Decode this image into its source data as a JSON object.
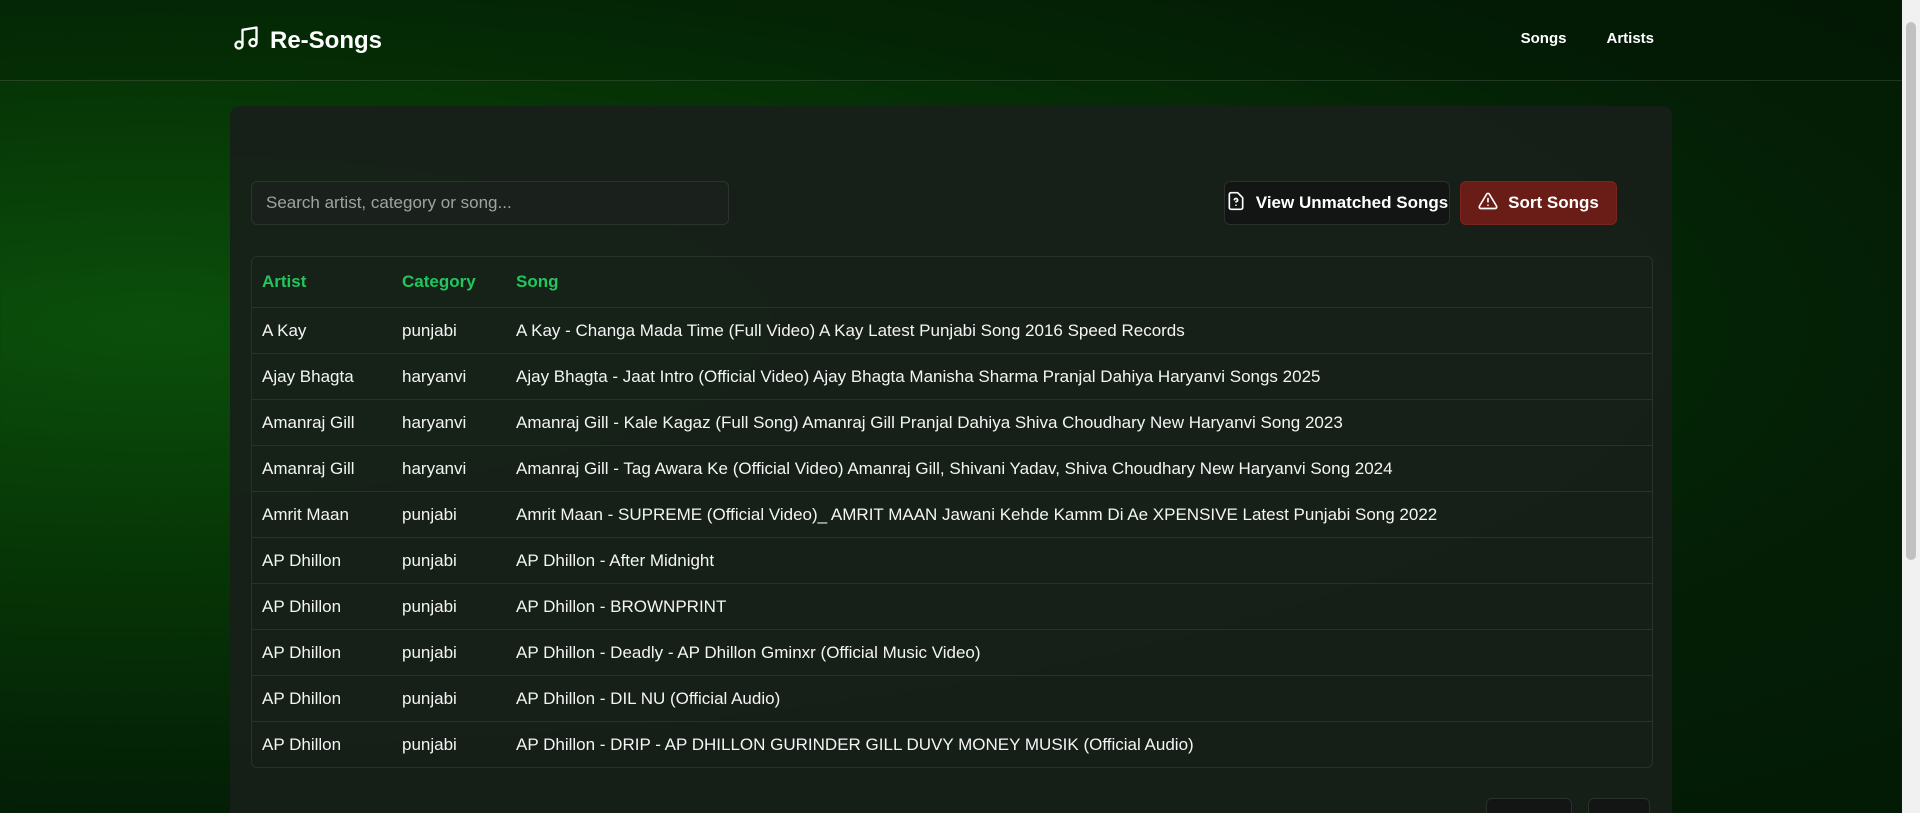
{
  "header": {
    "brand": "Re-Songs",
    "brand_icon": "music-note-icon",
    "nav": [
      "Songs",
      "Artists"
    ]
  },
  "search": {
    "placeholder": "Search artist, category or song...",
    "value": ""
  },
  "actions": {
    "unmatched_label": "View Unmatched Songs",
    "unmatched_icon": "file-question-icon",
    "sort_label": "Sort Songs",
    "sort_icon": "alert-triangle-icon"
  },
  "table": {
    "headers": [
      "Artist",
      "Category",
      "Song"
    ],
    "rows": [
      [
        "A Kay",
        "punjabi",
        "A Kay - Changa Mada Time (Full Video) A Kay Latest Punjabi Song 2016 Speed Records"
      ],
      [
        "Ajay Bhagta",
        "haryanvi",
        "Ajay Bhagta - Jaat Intro (Official Video) Ajay Bhagta Manisha Sharma Pranjal Dahiya Haryanvi Songs 2025"
      ],
      [
        "Amanraj Gill",
        "haryanvi",
        "Amanraj Gill - Kale Kagaz (Full Song) Amanraj Gill Pranjal Dahiya Shiva Choudhary New Haryanvi Song 2023"
      ],
      [
        "Amanraj Gill",
        "haryanvi",
        "Amanraj Gill - Tag Awara Ke (Official Video) Amanraj Gill, Shivani Yadav, Shiva Choudhary New Haryanvi Song 2024"
      ],
      [
        "Amrit Maan",
        "punjabi",
        "Amrit Maan - SUPREME (Official Video)_ AMRIT MAAN Jawani Kehde Kamm Di Ae XPENSIVE Latest Punjabi Song 2022"
      ],
      [
        "AP Dhillon",
        "punjabi",
        "AP Dhillon - After Midnight"
      ],
      [
        "AP Dhillon",
        "punjabi",
        "AP Dhillon - BROWNPRINT"
      ],
      [
        "AP Dhillon",
        "punjabi",
        "AP Dhillon - Deadly - AP Dhillon Gminxr (Official Music Video)"
      ],
      [
        "AP Dhillon",
        "punjabi",
        "AP Dhillon - DIL NU (Official Audio)"
      ],
      [
        "AP Dhillon",
        "punjabi",
        "AP Dhillon - DRIP - AP DHILLON GURINDER GILL DUVY MONEY MUSIK (Official Audio)"
      ]
    ]
  },
  "colors": {
    "accent": "#22c55e",
    "sort_button": "#6a1c17"
  }
}
